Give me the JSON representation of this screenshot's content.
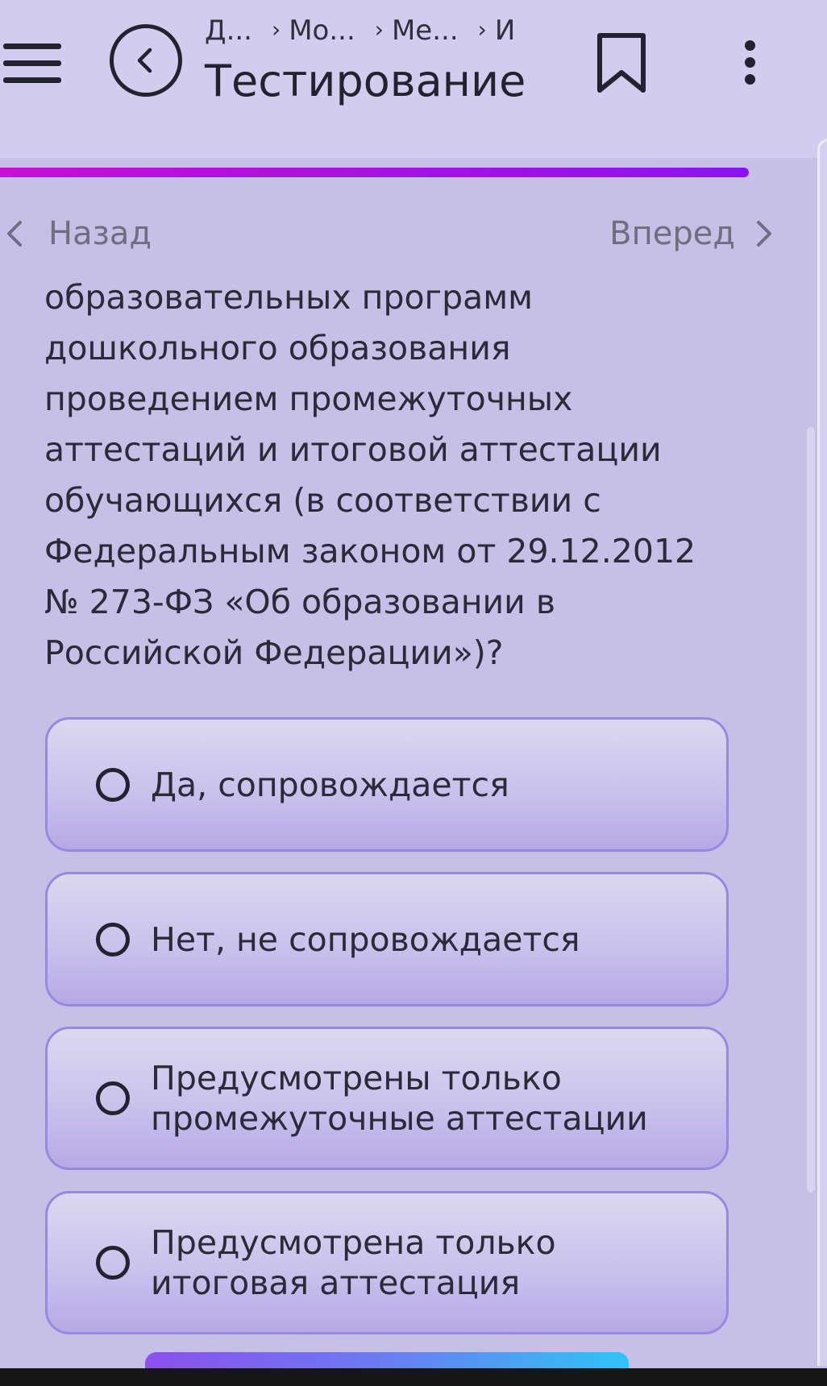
{
  "header": {
    "breadcrumbs": [
      "Д...",
      "Мо...",
      "Ме...",
      "И"
    ],
    "title": "Тестирование",
    "icons": {
      "menu": "hamburger-icon",
      "back": "back-circle-icon",
      "bookmark": "bookmark-icon",
      "more": "more-vertical-icon"
    }
  },
  "progress": {
    "percent": 95,
    "color_start": "#c80fd2",
    "color_end": "#8a14ef"
  },
  "nav": {
    "prev_label": "Назад",
    "next_label": "Вперед"
  },
  "question": {
    "lines": [
      "образовательных программ",
      "дошкольного образования",
      "проведением промежуточных",
      "аттестаций и итоговой аттестации",
      "обучающихся (в соответствии с",
      "Федеральным законом от 29.12.2012",
      "№ 273-ФЗ «Об образовании в",
      "Российской Федерации»)?"
    ]
  },
  "answers": [
    {
      "lines": [
        "Да, сопровождается"
      ],
      "selected": false
    },
    {
      "lines": [
        "Нет, не сопровождается"
      ],
      "selected": false
    },
    {
      "lines": [
        "Предусмотрены только",
        "промежуточные аттестации"
      ],
      "selected": false
    },
    {
      "lines": [
        "Предусмотрена только",
        "итоговая аттестация"
      ],
      "selected": false
    }
  ],
  "colors": {
    "background": "#c6bfe6",
    "header_background": "#d2cdee",
    "answer_border": "#9a88e0",
    "text": "#2a2a38",
    "nav_text": "#6e6e80"
  }
}
